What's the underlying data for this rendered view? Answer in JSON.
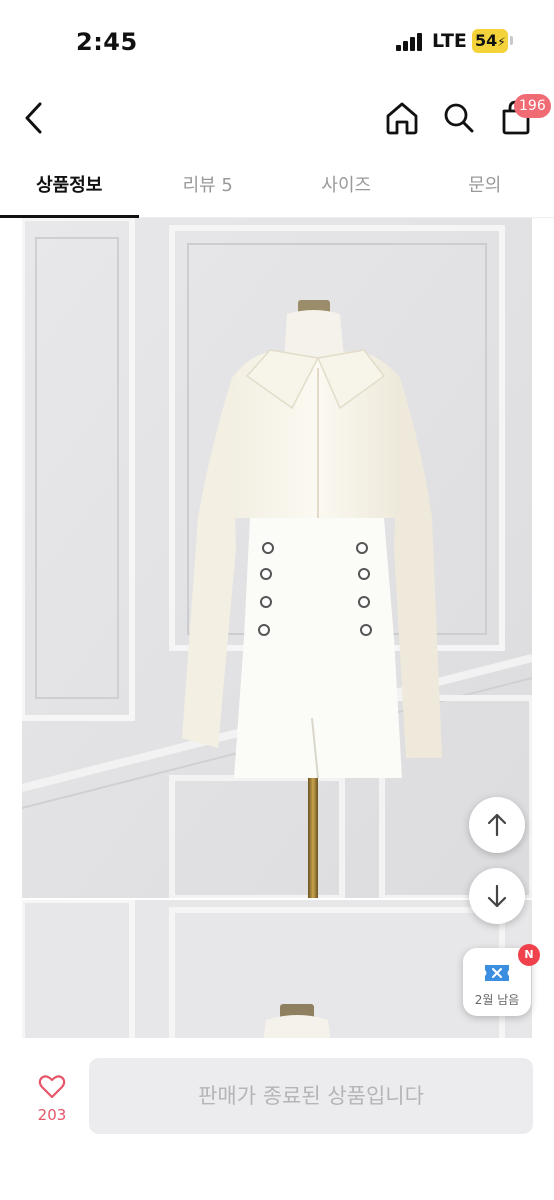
{
  "status_bar": {
    "time": "2:45",
    "network": "LTE",
    "battery": "54"
  },
  "header": {
    "cart_count": "196"
  },
  "tabs": [
    {
      "label": "상품정보",
      "active": true
    },
    {
      "label": "리뷰 5",
      "active": false
    },
    {
      "label": "사이즈",
      "active": false
    },
    {
      "label": "문의",
      "active": false
    }
  ],
  "coupon": {
    "label": "2월 남음",
    "badge": "N"
  },
  "bottom": {
    "like_count": "203",
    "sold_out_label": "판매가 종료된 상품입니다"
  },
  "icons": [
    "back-arrow-icon",
    "home-icon",
    "search-icon",
    "shopping-bag-icon",
    "arrow-up-icon",
    "arrow-down-icon",
    "coupon-ticket-icon",
    "heart-icon"
  ],
  "colors": {
    "badge": "#f06b74",
    "like": "#e5566a",
    "coupon_icon": "#3b8ee0",
    "disabled_bg": "#ececee",
    "disabled_text": "#b5b5b8"
  }
}
